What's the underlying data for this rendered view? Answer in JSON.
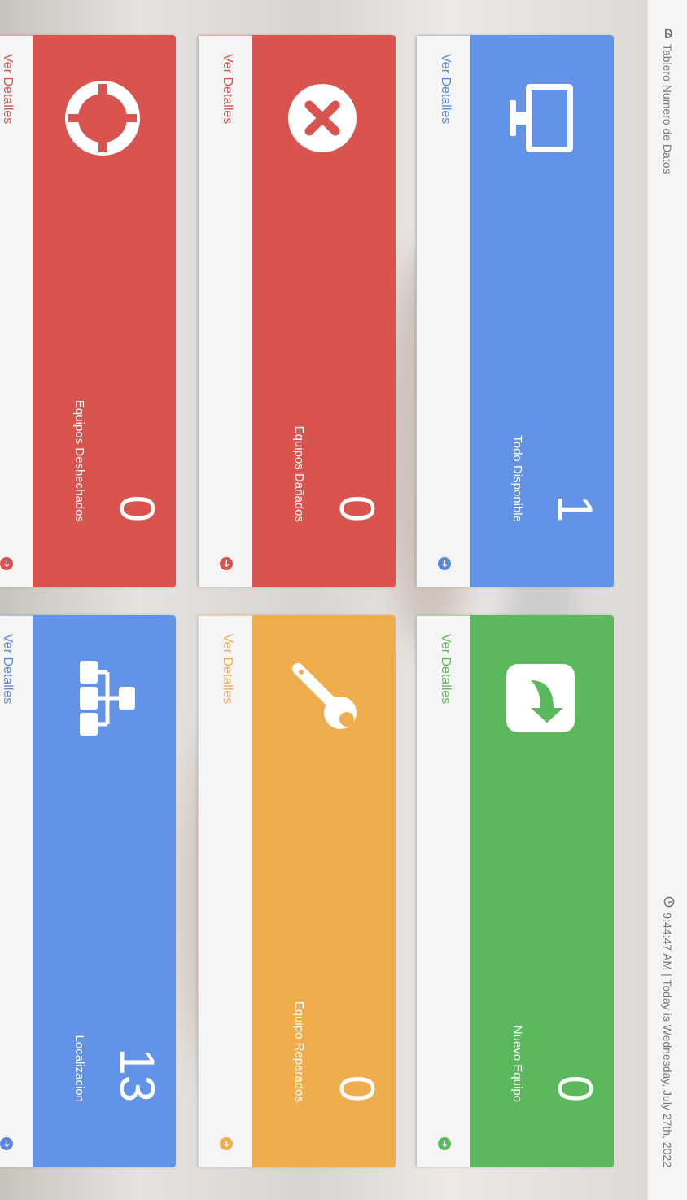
{
  "header": {
    "breadcrumb_label": "Tablero Numero de Datos",
    "breadcrumb_icon": "dashboard-icon",
    "clock_icon": "clock-icon",
    "datetime_text": "9:44:47 AM  |  Today is Wednesday, July 27th, 2022"
  },
  "panels": [
    {
      "color": "blue",
      "icon": "monitor-icon",
      "value": "1",
      "label": "Todo Disponible",
      "link": "Ver Detalles"
    },
    {
      "color": "green",
      "icon": "share-arrow-icon",
      "value": "0",
      "label": "Nuevo Equipo",
      "link": "Ver Detalles"
    },
    {
      "color": "red",
      "icon": "times-circle-icon",
      "value": "0",
      "label": "Equipos Dañados",
      "link": "Ver Detalles"
    },
    {
      "color": "orange",
      "icon": "wrench-icon",
      "value": "0",
      "label": "Equipo Reparados",
      "link": "Ver Detalles"
    },
    {
      "color": "red",
      "icon": "life-ring-icon",
      "value": "0",
      "label": "Equipos Deshechados",
      "link": "Ver Detalles"
    },
    {
      "color": "blue",
      "icon": "sitemap-icon",
      "value": "13",
      "label": "Localizacion",
      "link": "Ver Detalles"
    }
  ],
  "colors": {
    "blue": "#6293e6",
    "green": "#5cb85c",
    "red": "#d9534f",
    "orange": "#f0ad4e"
  }
}
